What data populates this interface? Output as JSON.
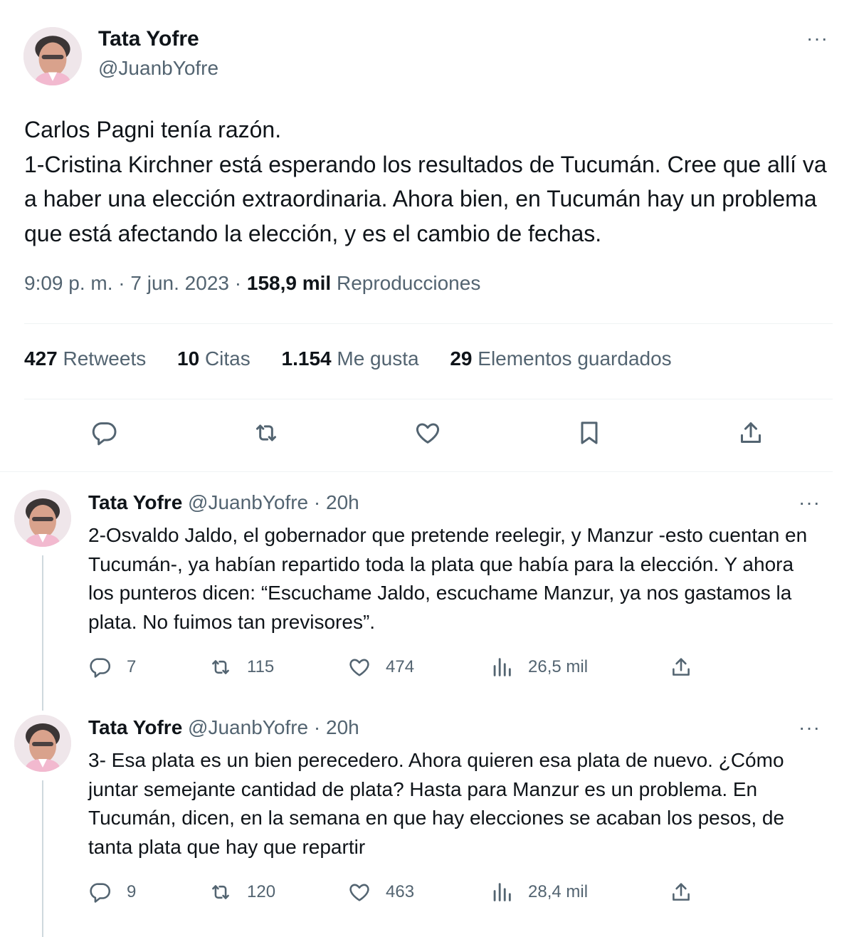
{
  "main_tweet": {
    "author_name": "Tata Yofre",
    "author_handle": "@JuanbYofre",
    "more_label": "···",
    "text": "Carlos Pagni tenía razón.\n1-Cristina Kirchner está esperando los resultados de Tucumán. Cree que allí va a haber una elección extraordinaria. Ahora bien, en Tucumán hay un problema que está afectando la elección, y es el cambio de fechas.",
    "time": "9:09 p. m.",
    "date": "7 jun. 2023",
    "views_count": "158,9 mil",
    "views_label": "Reproducciones",
    "stats": [
      {
        "count": "427",
        "label": "Retweets"
      },
      {
        "count": "10",
        "label": "Citas"
      },
      {
        "count": "1.154",
        "label": "Me gusta"
      },
      {
        "count": "29",
        "label": "Elementos guardados"
      }
    ],
    "actions": [
      "reply-icon",
      "retweet-icon",
      "like-icon",
      "bookmark-icon",
      "share-icon"
    ]
  },
  "replies": [
    {
      "author_name": "Tata Yofre",
      "author_handle": "@JuanbYofre",
      "time": "· 20h",
      "more_label": "···",
      "text": "2-Osvaldo Jaldo, el gobernador que pretende reelegir, y Manzur -esto cuentan en Tucumán-, ya habían repartido toda la plata que había para la elección. Y ahora los punteros dicen: “Escuchame Jaldo, escuchame Manzur, ya nos gastamos la plata. No fuimos tan previsores”.",
      "replies": "7",
      "retweets": "115",
      "likes": "474",
      "views": "26,5 mil"
    },
    {
      "author_name": "Tata Yofre",
      "author_handle": "@JuanbYofre",
      "time": "· 20h",
      "more_label": "···",
      "text": "3- Esa plata es un bien perecedero. Ahora quieren esa plata de nuevo. ¿Cómo juntar semejante cantidad de plata? Hasta para Manzur es un problema. En Tucumán, dicen, en la semana en que hay elecciones se acaban los pesos, de tanta plata que hay que repartir",
      "replies": "9",
      "retweets": "120",
      "likes": "463",
      "views": "28,4 mil"
    }
  ],
  "colors": {
    "text": "#0f1419",
    "muted": "#536471",
    "divider": "#eff3f4",
    "thread_line": "#cfd9de"
  }
}
